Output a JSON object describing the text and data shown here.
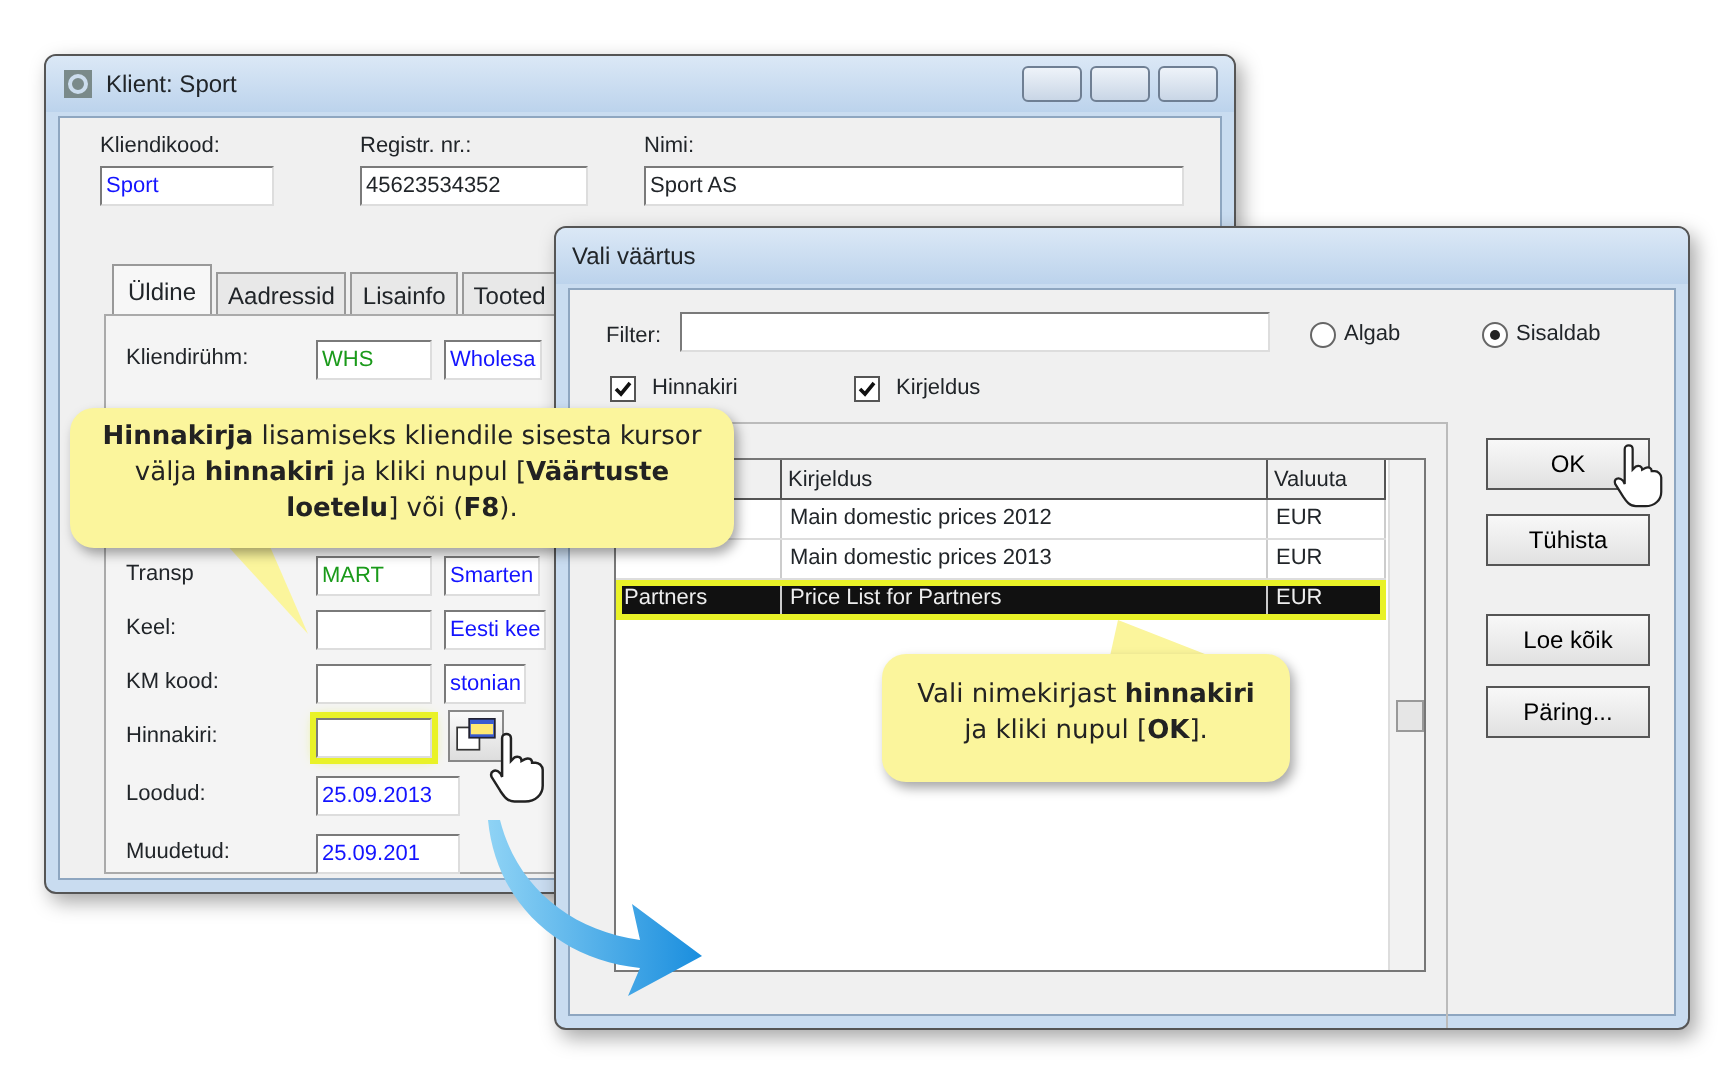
{
  "client_window": {
    "title": "Klient: Sport",
    "header_fields": [
      {
        "label": "Kliendikood:",
        "value": "Sport",
        "link": true
      },
      {
        "label": "Registr. nr.:",
        "value": "45623534352",
        "link": false
      },
      {
        "label": "Nimi:",
        "value": "Sport AS",
        "link": false
      }
    ],
    "tabs": [
      {
        "label": "Üldine",
        "selected": true
      },
      {
        "label": "Aadressid",
        "selected": false
      },
      {
        "label": "Lisainfo",
        "selected": false
      },
      {
        "label": "Tooted",
        "selected": false
      }
    ],
    "rows": [
      {
        "kind": "pair",
        "label": "Kliendirühm:",
        "value": "WHS",
        "detail": "Wholesa"
      },
      {
        "kind": "hidden"
      },
      {
        "kind": "hidden"
      },
      {
        "kind": "hidden"
      },
      {
        "kind": "pair",
        "label": "Transp",
        "value": "MART",
        "detail": "Smarten"
      },
      {
        "kind": "pair",
        "label": "Keel:",
        "value": "",
        "detail": "Eesti kee"
      },
      {
        "kind": "pair",
        "label": "KM kood:",
        "value": "",
        "detail": "stonian"
      },
      {
        "kind": "highlight",
        "label": "Hinnakiri:",
        "value": ""
      },
      {
        "kind": "date",
        "label": "Loodud:",
        "value": "25.09.2013"
      },
      {
        "kind": "date",
        "label": "Muudetud:",
        "value": "25.09.201"
      }
    ]
  },
  "dialog": {
    "title": "Vali väärtus",
    "filter_label": "Filter:",
    "radios": [
      {
        "label": "Algab",
        "selected": false
      },
      {
        "label": "Sisaldab",
        "selected": true
      }
    ],
    "checkboxes": [
      {
        "label": "Hinnakiri",
        "checked": true
      },
      {
        "label": "Kirjeldus",
        "checked": true
      }
    ],
    "table": {
      "columns": [
        "Kirjeldus",
        "Valuuta"
      ],
      "rows": [
        {
          "code": "",
          "description": "Main domestic prices 2012",
          "currency": "EUR",
          "selected": false
        },
        {
          "code": "",
          "description": "Main domestic prices 2013",
          "currency": "EUR",
          "selected": false
        },
        {
          "code": "Partners",
          "description": "Price List for Partners",
          "currency": "EUR",
          "selected": true
        }
      ]
    },
    "buttons": [
      {
        "label": "OK"
      },
      {
        "label": "Tühista"
      },
      {
        "label": "Loe kõik"
      },
      {
        "label": "Päring..."
      }
    ]
  },
  "callouts": [
    "**Hinnakirja** lisamiseks kliendile sisesta kursor välja **hinnakiri** ja kliki nupul [**Väärtuste loetelu**] või (**F8**).",
    "Vali nimekirjast **hinnakiri** ja kliki nupul [**OK**]."
  ]
}
